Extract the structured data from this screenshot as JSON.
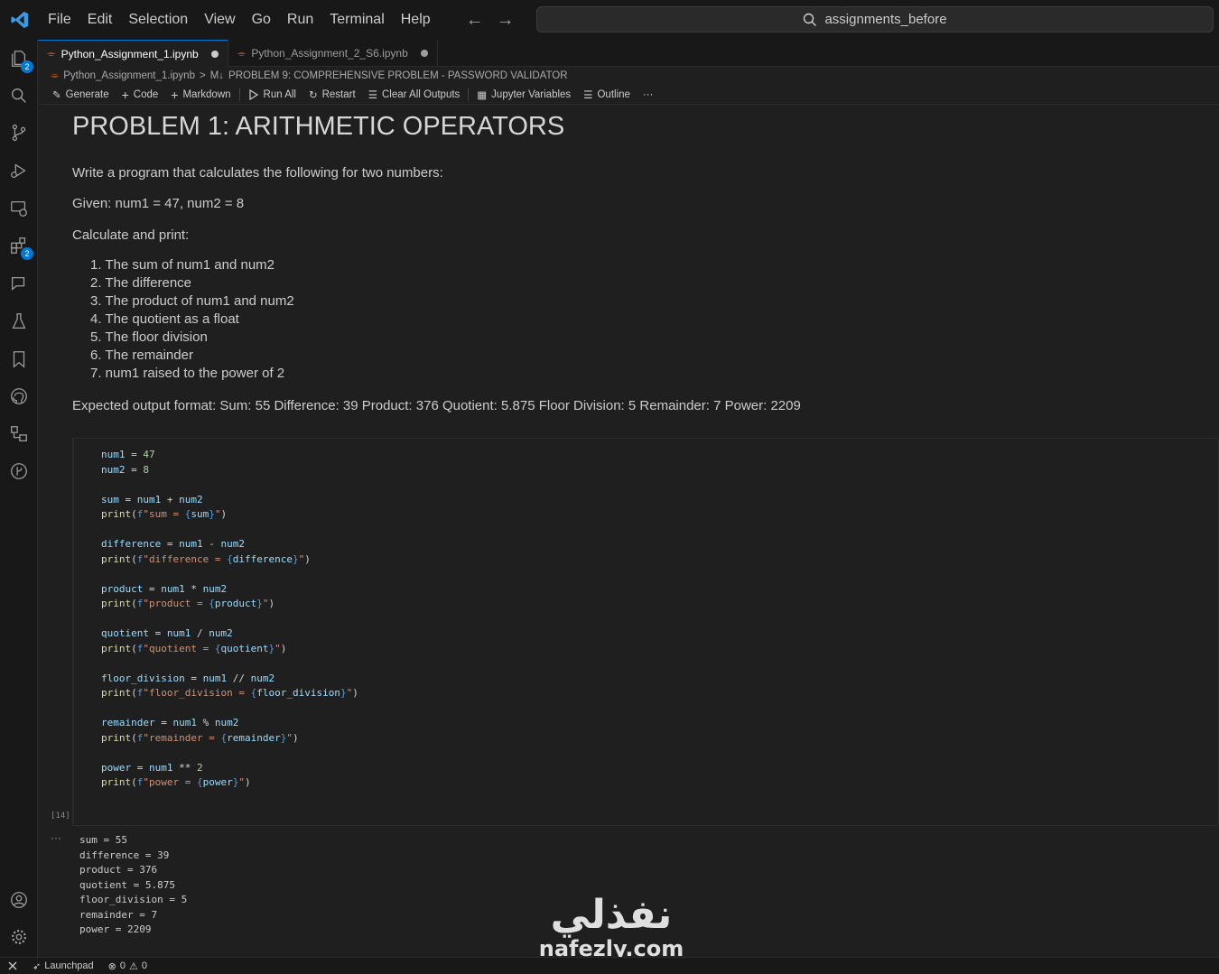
{
  "titlebar": {
    "menu": [
      "File",
      "Edit",
      "Selection",
      "View",
      "Go",
      "Run",
      "Terminal",
      "Help"
    ],
    "search_text": "assignments_before"
  },
  "activity_bar": {
    "explorer_badge": "2",
    "extensions_badge": "2"
  },
  "tabs": [
    {
      "label": "Python_Assignment_1.ipynb",
      "active": true
    },
    {
      "label": "Python_Assignment_2_S6.ipynb",
      "active": false
    }
  ],
  "breadcrumb": {
    "file": "Python_Assignment_1.ipynb",
    "separator": ">",
    "md_marker": "M↓",
    "section": "PROBLEM 9: COMPREHENSIVE PROBLEM - PASSWORD VALIDATOR"
  },
  "toolbar": {
    "generate": "Generate",
    "code": "Code",
    "markdown": "Markdown",
    "run_all": "Run All",
    "restart": "Restart",
    "clear_outputs": "Clear All Outputs",
    "jupyter_variables": "Jupyter Variables",
    "outline": "Outline",
    "more": "···"
  },
  "markdown_cell": {
    "heading": "PROBLEM 1: ARITHMETIC OPERATORS",
    "intro": "Write a program that calculates the following for two numbers:",
    "given": "Given: num1 = 47, num2 = 8",
    "calc": "Calculate and print:",
    "items": [
      "1. The sum of num1 and num2",
      "2. The difference",
      "3. The product of num1 and num2",
      "4. The quotient as a float",
      "5. The floor division",
      "6. The remainder",
      "7. num1 raised to the power of 2"
    ],
    "expected": "Expected output format: Sum: 55 Difference: 39 Product: 376 Quotient: 5.875 Floor Division: 5 Remainder: 7 Power: 2209"
  },
  "code_cell": {
    "execution_count": "[14]",
    "output_marker": "···",
    "output_lines": [
      "sum = 55",
      "difference = 39",
      "product = 376",
      "quotient = 5.875",
      "floor_division = 5",
      "remainder = 7",
      "power = 2209"
    ]
  },
  "watermark": {
    "arabic": "نفذلي",
    "latin": "nafezly.com"
  },
  "statusbar": {
    "launchpad": "Launchpad",
    "errors": "0",
    "warnings": "0"
  },
  "colors": {
    "accent": "#0078d4",
    "variable": "#9cdcfe",
    "function": "#dcdcaa",
    "string": "#ce9178",
    "number": "#b5cea8"
  }
}
